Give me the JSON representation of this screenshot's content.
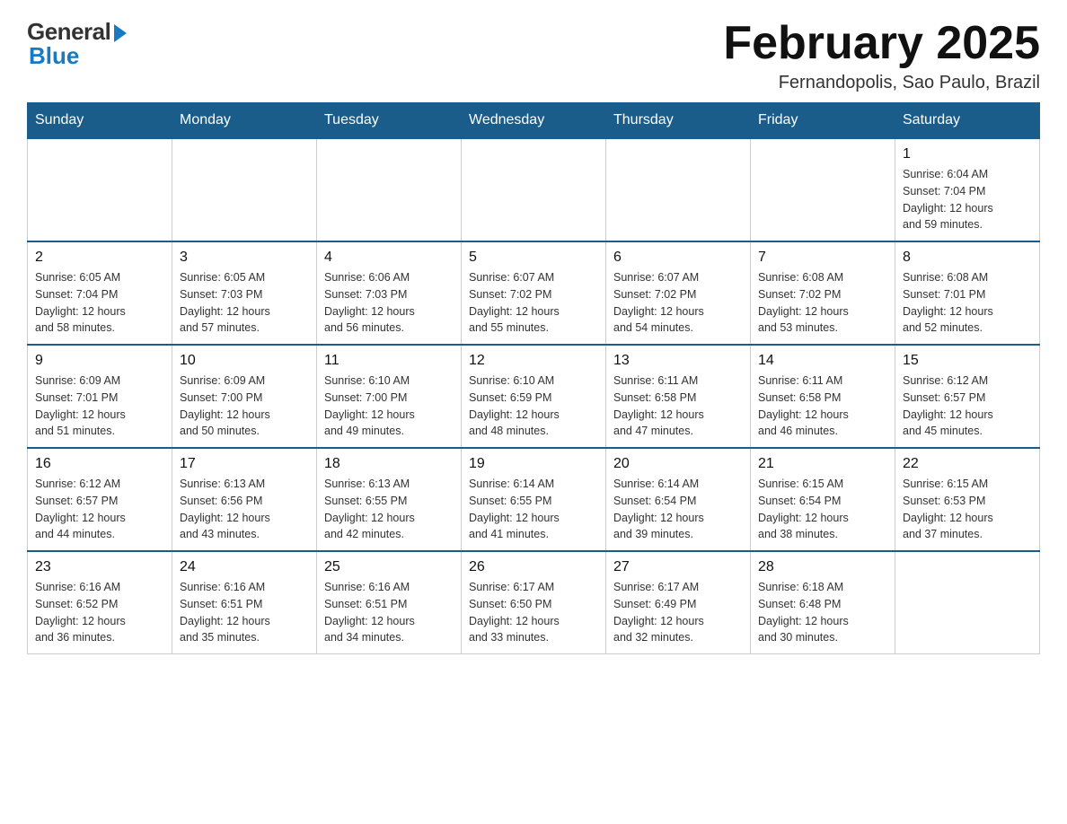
{
  "header": {
    "logo_general": "General",
    "logo_blue": "Blue",
    "month_title": "February 2025",
    "location": "Fernandopolis, Sao Paulo, Brazil"
  },
  "days_of_week": [
    "Sunday",
    "Monday",
    "Tuesday",
    "Wednesday",
    "Thursday",
    "Friday",
    "Saturday"
  ],
  "weeks": [
    [
      {
        "day": "",
        "info": ""
      },
      {
        "day": "",
        "info": ""
      },
      {
        "day": "",
        "info": ""
      },
      {
        "day": "",
        "info": ""
      },
      {
        "day": "",
        "info": ""
      },
      {
        "day": "",
        "info": ""
      },
      {
        "day": "1",
        "info": "Sunrise: 6:04 AM\nSunset: 7:04 PM\nDaylight: 12 hours\nand 59 minutes."
      }
    ],
    [
      {
        "day": "2",
        "info": "Sunrise: 6:05 AM\nSunset: 7:04 PM\nDaylight: 12 hours\nand 58 minutes."
      },
      {
        "day": "3",
        "info": "Sunrise: 6:05 AM\nSunset: 7:03 PM\nDaylight: 12 hours\nand 57 minutes."
      },
      {
        "day": "4",
        "info": "Sunrise: 6:06 AM\nSunset: 7:03 PM\nDaylight: 12 hours\nand 56 minutes."
      },
      {
        "day": "5",
        "info": "Sunrise: 6:07 AM\nSunset: 7:02 PM\nDaylight: 12 hours\nand 55 minutes."
      },
      {
        "day": "6",
        "info": "Sunrise: 6:07 AM\nSunset: 7:02 PM\nDaylight: 12 hours\nand 54 minutes."
      },
      {
        "day": "7",
        "info": "Sunrise: 6:08 AM\nSunset: 7:02 PM\nDaylight: 12 hours\nand 53 minutes."
      },
      {
        "day": "8",
        "info": "Sunrise: 6:08 AM\nSunset: 7:01 PM\nDaylight: 12 hours\nand 52 minutes."
      }
    ],
    [
      {
        "day": "9",
        "info": "Sunrise: 6:09 AM\nSunset: 7:01 PM\nDaylight: 12 hours\nand 51 minutes."
      },
      {
        "day": "10",
        "info": "Sunrise: 6:09 AM\nSunset: 7:00 PM\nDaylight: 12 hours\nand 50 minutes."
      },
      {
        "day": "11",
        "info": "Sunrise: 6:10 AM\nSunset: 7:00 PM\nDaylight: 12 hours\nand 49 minutes."
      },
      {
        "day": "12",
        "info": "Sunrise: 6:10 AM\nSunset: 6:59 PM\nDaylight: 12 hours\nand 48 minutes."
      },
      {
        "day": "13",
        "info": "Sunrise: 6:11 AM\nSunset: 6:58 PM\nDaylight: 12 hours\nand 47 minutes."
      },
      {
        "day": "14",
        "info": "Sunrise: 6:11 AM\nSunset: 6:58 PM\nDaylight: 12 hours\nand 46 minutes."
      },
      {
        "day": "15",
        "info": "Sunrise: 6:12 AM\nSunset: 6:57 PM\nDaylight: 12 hours\nand 45 minutes."
      }
    ],
    [
      {
        "day": "16",
        "info": "Sunrise: 6:12 AM\nSunset: 6:57 PM\nDaylight: 12 hours\nand 44 minutes."
      },
      {
        "day": "17",
        "info": "Sunrise: 6:13 AM\nSunset: 6:56 PM\nDaylight: 12 hours\nand 43 minutes."
      },
      {
        "day": "18",
        "info": "Sunrise: 6:13 AM\nSunset: 6:55 PM\nDaylight: 12 hours\nand 42 minutes."
      },
      {
        "day": "19",
        "info": "Sunrise: 6:14 AM\nSunset: 6:55 PM\nDaylight: 12 hours\nand 41 minutes."
      },
      {
        "day": "20",
        "info": "Sunrise: 6:14 AM\nSunset: 6:54 PM\nDaylight: 12 hours\nand 39 minutes."
      },
      {
        "day": "21",
        "info": "Sunrise: 6:15 AM\nSunset: 6:54 PM\nDaylight: 12 hours\nand 38 minutes."
      },
      {
        "day": "22",
        "info": "Sunrise: 6:15 AM\nSunset: 6:53 PM\nDaylight: 12 hours\nand 37 minutes."
      }
    ],
    [
      {
        "day": "23",
        "info": "Sunrise: 6:16 AM\nSunset: 6:52 PM\nDaylight: 12 hours\nand 36 minutes."
      },
      {
        "day": "24",
        "info": "Sunrise: 6:16 AM\nSunset: 6:51 PM\nDaylight: 12 hours\nand 35 minutes."
      },
      {
        "day": "25",
        "info": "Sunrise: 6:16 AM\nSunset: 6:51 PM\nDaylight: 12 hours\nand 34 minutes."
      },
      {
        "day": "26",
        "info": "Sunrise: 6:17 AM\nSunset: 6:50 PM\nDaylight: 12 hours\nand 33 minutes."
      },
      {
        "day": "27",
        "info": "Sunrise: 6:17 AM\nSunset: 6:49 PM\nDaylight: 12 hours\nand 32 minutes."
      },
      {
        "day": "28",
        "info": "Sunrise: 6:18 AM\nSunset: 6:48 PM\nDaylight: 12 hours\nand 30 minutes."
      },
      {
        "day": "",
        "info": ""
      }
    ]
  ]
}
